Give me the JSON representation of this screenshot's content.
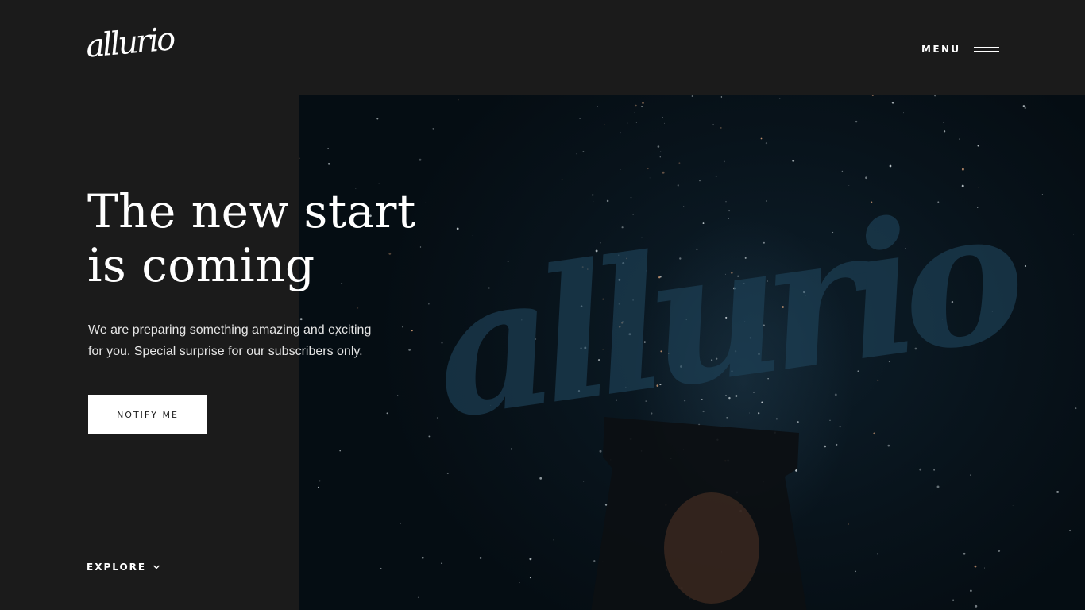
{
  "header": {
    "logo_text": "allurio",
    "menu_label": "MENU"
  },
  "hero": {
    "headline_line1": "The new start",
    "headline_line2": "is coming",
    "description_line1": "We are preparing something amazing and exciting",
    "description_line2": "for you. Special surprise for our subscribers only.",
    "cta_label": "NOTIFY ME",
    "watermark_text": "allurio"
  },
  "footer": {
    "explore_label": "EXPLORE"
  },
  "icons": {
    "menu": "hamburger-icon",
    "explore": "chevron-down-icon"
  },
  "colors": {
    "background": "#1b1b1b",
    "text": "#ffffff",
    "button_bg": "#ffffff",
    "button_text": "#1b1b1b",
    "image_tone": "#0b1a24"
  }
}
